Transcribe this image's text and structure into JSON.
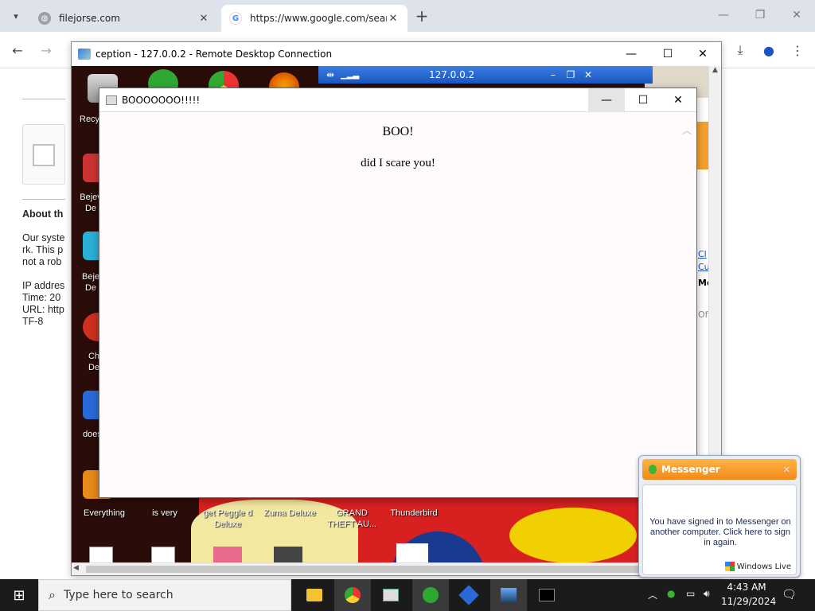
{
  "browser": {
    "tabs": [
      {
        "title": "filejorse.com",
        "active": false
      },
      {
        "title": "https://www.google.com/search",
        "active": true
      }
    ],
    "new_tab": "+",
    "page_text": {
      "heading": "About th",
      "para1": "Our syste",
      "para2": "rk. This p",
      "para3": "not a rob",
      "ip": "IP addres",
      "time": "Time: 20",
      "url": "URL: http",
      "enc": "TF-8"
    }
  },
  "rdp": {
    "title": "ception - 127.0.0.2 - Remote Desktop Connection",
    "inner_bar_title": "127.0.0.2"
  },
  "desktop": {
    "left_icons": [
      {
        "label": "Recy"
      },
      {
        "label": "Bejev\nDe"
      },
      {
        "label": "Beje\nDe"
      },
      {
        "label": "Ch\nDe"
      },
      {
        "label": "does"
      }
    ],
    "bottom_icons": [
      {
        "label": "Everything"
      },
      {
        "label": "is very"
      },
      {
        "label": "get Peggle d\nDeluxe"
      },
      {
        "label": "Zuma Deluxe"
      },
      {
        "label": "GRAND\nTHEFT AU..."
      },
      {
        "label": "Thunderbird"
      }
    ],
    "right_strip": [
      "Cl",
      "Cu",
      "Mo",
      "Of"
    ]
  },
  "boo_window": {
    "title": "BOOOOOOO!!!!!",
    "heading": "BOO!",
    "message": "did I scare you!"
  },
  "messenger": {
    "title": "Messenger",
    "body": "You have signed in to Messenger on another computer. Click here to sign in again.",
    "brand": "Windows Live"
  },
  "taskbar": {
    "search_placeholder": "Type here to search",
    "time": "4:43 AM",
    "date": "11/29/2024"
  },
  "colors": {
    "tabstrip": "#dee3eb",
    "taskbar": "#1b1b1b",
    "messenger_header": "#f28a1a",
    "boo_bg": "#fffbfd"
  }
}
